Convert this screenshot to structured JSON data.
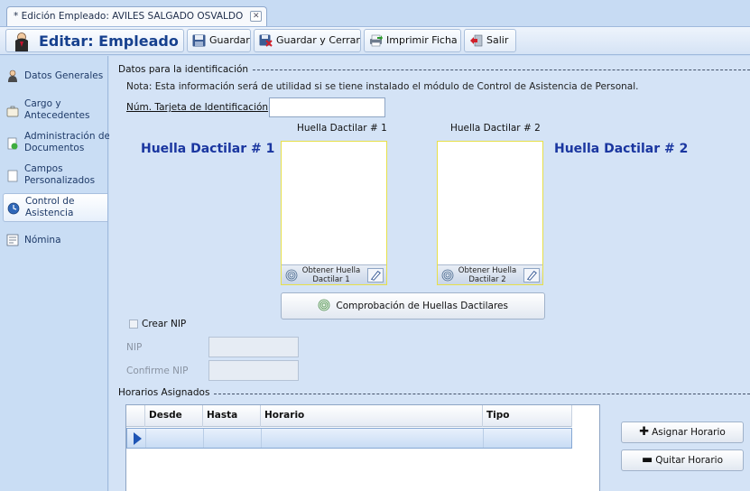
{
  "document_tab": {
    "title": "* Edición Empleado: AVILES SALGADO OSVALDO",
    "close_glyph": "✕"
  },
  "toolbar": {
    "title": "Editar: Empleado",
    "save_label": "Guardar",
    "save_close_label": "Guardar y Cerrar",
    "print_label": "Imprimir Ficha",
    "exit_label": "Salir"
  },
  "sidebar": {
    "items": [
      {
        "label": "Datos Generales",
        "icon": "person-icon"
      },
      {
        "label": "Cargo y Antecedentes",
        "icon": "briefcase-icon"
      },
      {
        "label": "Administración de Documentos",
        "icon": "documents-icon"
      },
      {
        "label": "Campos Personalizados",
        "icon": "form-icon"
      },
      {
        "label": "Control de Asistencia",
        "icon": "clock-icon"
      },
      {
        "label": "Nómina",
        "icon": "payroll-icon"
      }
    ]
  },
  "identification": {
    "section_title": "Datos para la identificación",
    "note": "Nota: Esta información será de utilidad si se tiene instalado el módulo de Control de Asistencia de Personal.",
    "card_label": "Núm. Tarjeta de Identificación",
    "card_value": "",
    "fingerprint1_big": "Huella Dactilar # 1",
    "fingerprint2_big": "Huella Dactilar # 2",
    "fingerprint1_caption": "Huella Dactilar # 1",
    "fingerprint2_caption": "Huella Dactilar # 2",
    "capture1_label": "Obtener Huella Dactilar 1",
    "capture2_label": "Obtener Huella Dactilar 2",
    "verify_label": "Comprobación de Huellas Dactilares",
    "create_nip_label": "Crear NIP",
    "nip_label": "NIP",
    "confirm_nip_label": "Confirme NIP",
    "nip_value": "",
    "confirm_nip_value": ""
  },
  "schedules": {
    "section_title": "Horarios Asignados",
    "columns": [
      "Desde",
      "Hasta",
      "Horario",
      "Tipo"
    ],
    "assign_label": "Asignar Horario",
    "remove_label": "Quitar Horario"
  },
  "colors": {
    "accent": "#16408e",
    "big_label": "#1a36a0",
    "fp_border": "#e7e04a"
  }
}
